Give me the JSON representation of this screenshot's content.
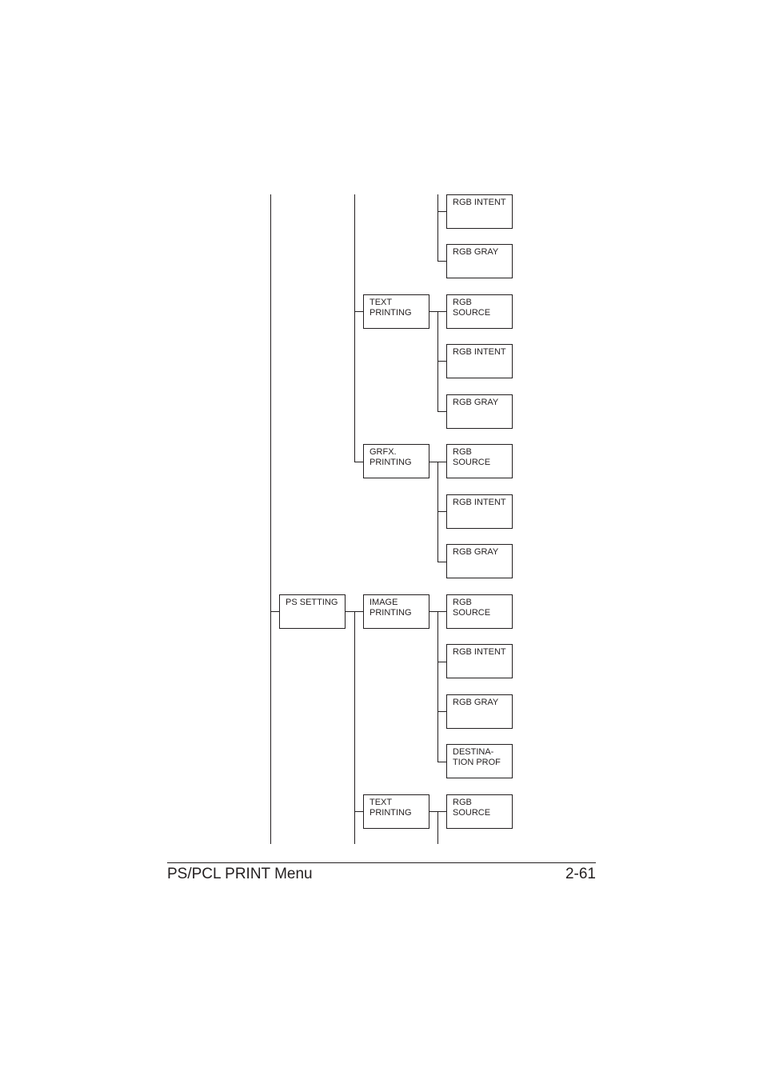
{
  "diagram": {
    "nodes": {
      "ps_setting": "PS SETTING",
      "text_printing_1": "TEXT\nPRINTING",
      "grfx_printing_1": "GRFX.\nPRINTING",
      "image_printing_2": "IMAGE\nPRINTING",
      "text_printing_2": "TEXT\nPRINTING",
      "rgb_intent_a": "RGB INTENT",
      "rgb_gray_a": "RGB GRAY",
      "rgb_source_b": "RGB\nSOURCE",
      "rgb_intent_b": "RGB INTENT",
      "rgb_gray_b": "RGB GRAY",
      "rgb_source_c": "RGB\nSOURCE",
      "rgb_intent_c": "RGB INTENT",
      "rgb_gray_c": "RGB GRAY",
      "rgb_source_d": "RGB\nSOURCE",
      "rgb_intent_d": "RGB INTENT",
      "rgb_gray_d": "RGB GRAY",
      "destination_prof_d": "DESTINA-\nTION PROF",
      "rgb_source_e": "RGB\nSOURCE"
    }
  },
  "footer": {
    "title": "PS/PCL PRINT Menu",
    "page": "2-61"
  }
}
